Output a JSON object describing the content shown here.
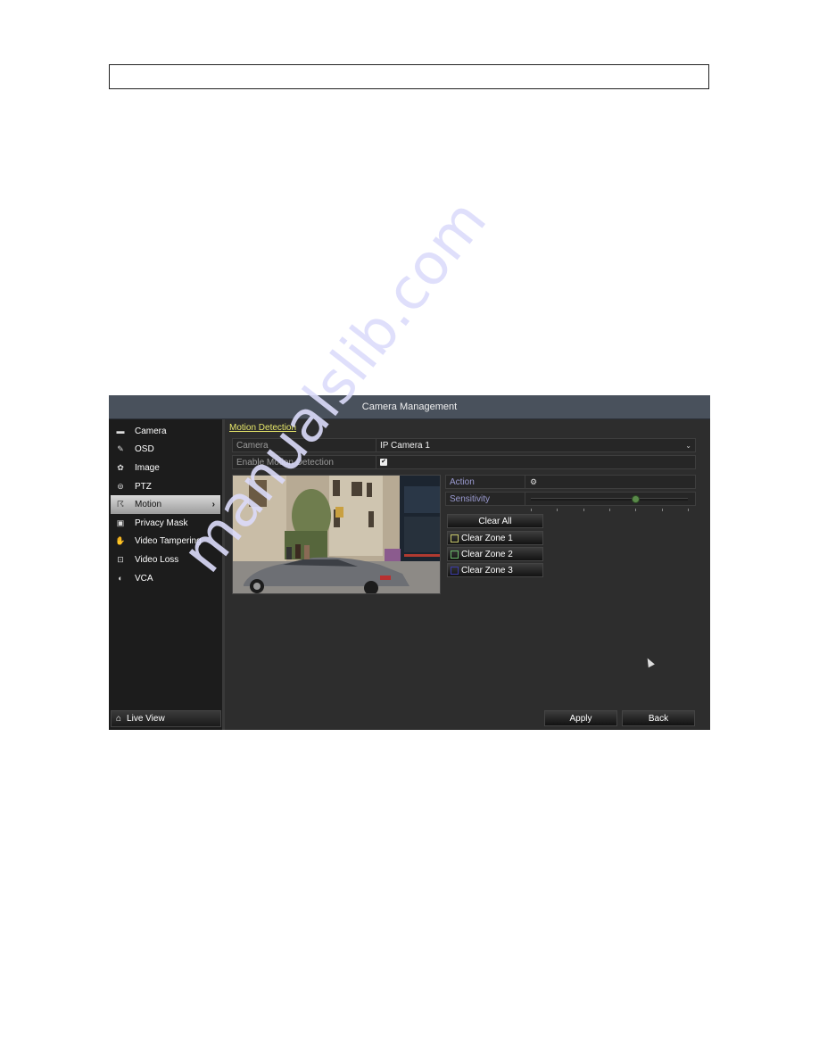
{
  "page": {
    "header_box_text": "",
    "watermark": "manualslib.com"
  },
  "app": {
    "title": "Camera Management",
    "sidebar": {
      "items": [
        {
          "label": "Camera",
          "icon": "camera-icon",
          "glyph": "▬"
        },
        {
          "label": "OSD",
          "icon": "osd-icon",
          "glyph": "✎"
        },
        {
          "label": "Image",
          "icon": "image-icon",
          "glyph": "✿"
        },
        {
          "label": "PTZ",
          "icon": "ptz-icon",
          "glyph": "⊜"
        },
        {
          "label": "Motion",
          "icon": "motion-icon",
          "glyph": "☈",
          "active": true,
          "chevron": "›"
        },
        {
          "label": "Privacy Mask",
          "icon": "privacy-mask-icon",
          "glyph": "▣"
        },
        {
          "label": "Video Tampering",
          "icon": "video-tampering-icon",
          "glyph": "✋"
        },
        {
          "label": "Video Loss",
          "icon": "video-loss-icon",
          "glyph": "⊡"
        },
        {
          "label": "VCA",
          "icon": "vca-icon",
          "glyph": "◐"
        }
      ],
      "live_view": {
        "label": "Live View",
        "glyph": "⌂"
      }
    },
    "main": {
      "section_title": "Motion Detection",
      "camera": {
        "label": "Camera",
        "value": "IP Camera 1",
        "arrow": "⌄"
      },
      "enable": {
        "label": "Enable Motion Detection",
        "checked": true,
        "check_glyph": "✔"
      },
      "action": {
        "label": "Action",
        "glyph": "⚙"
      },
      "sensitivity": {
        "label": "Sensitivity",
        "level": 4,
        "min": 0,
        "max": 6
      },
      "clear_all": "Clear All",
      "zones": [
        {
          "label": "Clear Zone 1",
          "color": "#c8c86a"
        },
        {
          "label": "Clear Zone 2",
          "color": "#6ab86a"
        },
        {
          "label": "Clear Zone 3",
          "color": "#3c3ca8"
        }
      ],
      "apply": "Apply",
      "back": "Back"
    },
    "colors": {
      "section_title": "#e8e86a",
      "titlebar": "#49515c",
      "background": "#2d2d2d"
    }
  }
}
